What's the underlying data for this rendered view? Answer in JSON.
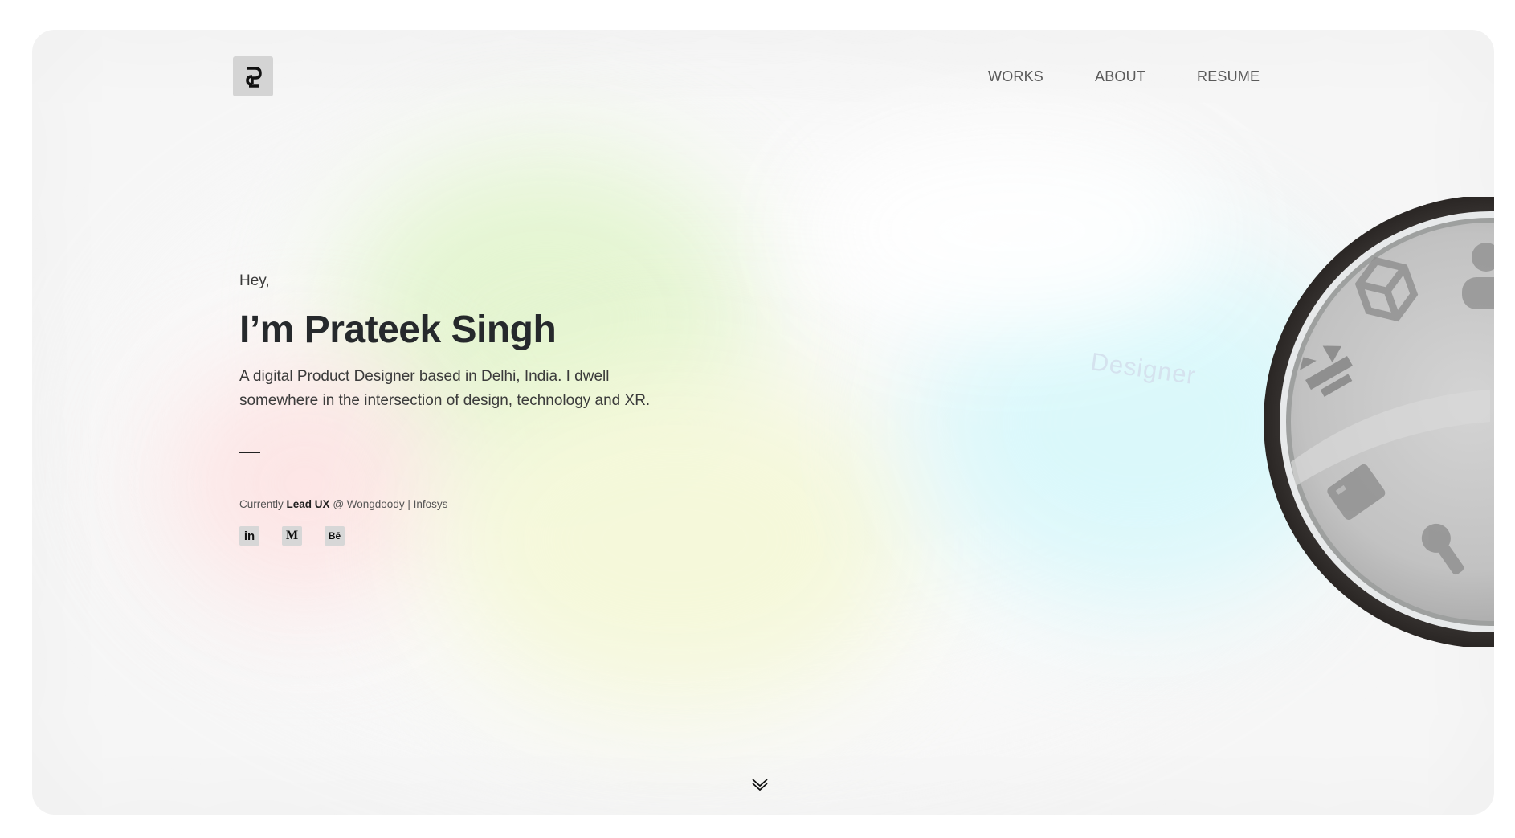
{
  "nav": {
    "items": [
      "WORKS",
      "ABOUT",
      "RESUME"
    ]
  },
  "hero": {
    "greeting": "Hey,",
    "name": "I’m Prateek Singh",
    "description": "A digital Product Designer based in Delhi, India. I dwell somewhere in the intersection of design, technology and XR.",
    "currently_prefix": "Currently",
    "role": "Lead UX",
    "company": "@ Wongdoody | Infosys"
  },
  "socials": [
    {
      "name": "linkedin-icon",
      "glyph": "in"
    },
    {
      "name": "medium-icon",
      "glyph": "M"
    },
    {
      "name": "behance-icon",
      "glyph": "Bē"
    }
  ],
  "dial": {
    "active_label": "Designer"
  },
  "colors": {
    "accent_green": "#e3f5cf",
    "accent_cyan": "#d9f8fb",
    "accent_pink": "#fde3e3",
    "accent_yellow": "#f5f8d9"
  }
}
